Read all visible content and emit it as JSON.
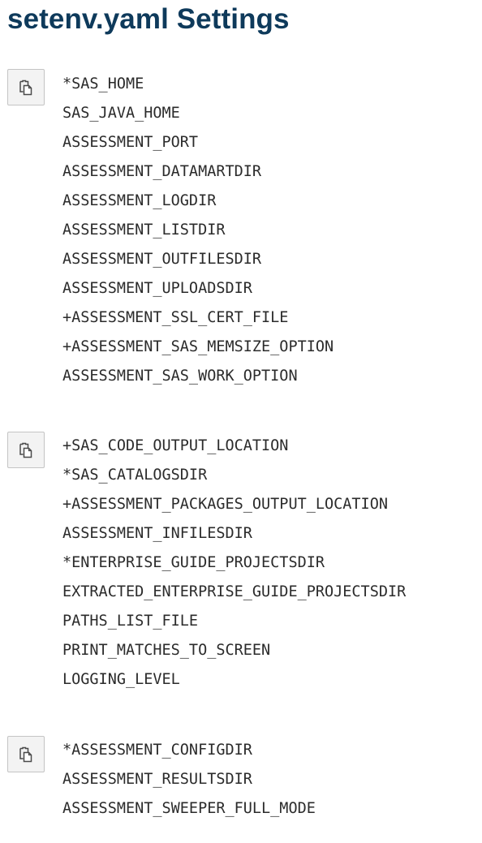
{
  "page": {
    "title": "setenv.yaml Settings"
  },
  "blocks": [
    {
      "lines": [
        "*SAS_HOME",
        "SAS_JAVA_HOME",
        "ASSESSMENT_PORT",
        "ASSESSMENT_DATAMARTDIR",
        "ASSESSMENT_LOGDIR",
        "ASSESSMENT_LISTDIR",
        "ASSESSMENT_OUTFILESDIR",
        "ASSESSMENT_UPLOADSDIR",
        "+ASSESSMENT_SSL_CERT_FILE",
        "+ASSESSMENT_SAS_MEMSIZE_OPTION",
        "ASSESSMENT_SAS_WORK_OPTION"
      ]
    },
    {
      "lines": [
        "+SAS_CODE_OUTPUT_LOCATION",
        "*SAS_CATALOGSDIR",
        "+ASSESSMENT_PACKAGES_OUTPUT_LOCATION",
        "ASSESSMENT_INFILESDIR",
        "*ENTERPRISE_GUIDE_PROJECTSDIR",
        "EXTRACTED_ENTERPRISE_GUIDE_PROJECTSDIR",
        "PATHS_LIST_FILE",
        "PRINT_MATCHES_TO_SCREEN",
        "LOGGING_LEVEL"
      ]
    },
    {
      "lines": [
        "*ASSESSMENT_CONFIGDIR",
        "ASSESSMENT_RESULTSDIR",
        "ASSESSMENT_SWEEPER_FULL_MODE"
      ]
    }
  ],
  "icons": {
    "copy": "copy-icon"
  },
  "colors": {
    "title": "#0e3a5b",
    "code_text": "#2b2b2b",
    "button_background": "#f3f3f3",
    "button_border": "#c4c4c4"
  }
}
